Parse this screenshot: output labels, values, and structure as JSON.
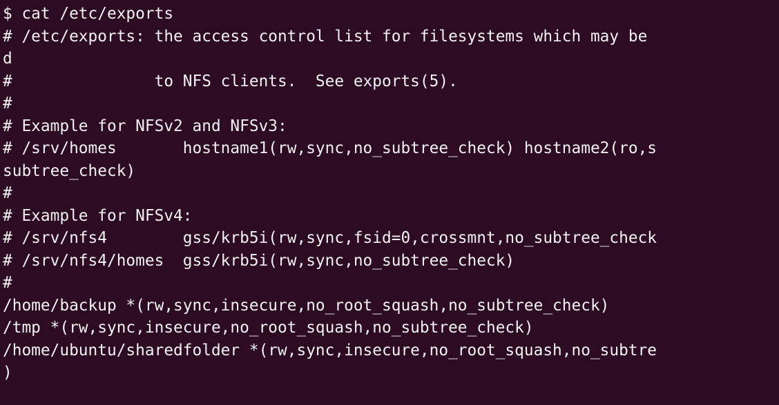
{
  "terminal": {
    "lines": [
      "$ cat /etc/exports",
      "# /etc/exports: the access control list for filesystems which may be",
      "d",
      "#               to NFS clients.  See exports(5).",
      "#",
      "# Example for NFSv2 and NFSv3:",
      "# /srv/homes       hostname1(rw,sync,no_subtree_check) hostname2(ro,s",
      "subtree_check)",
      "#",
      "# Example for NFSv4:",
      "# /srv/nfs4        gss/krb5i(rw,sync,fsid=0,crossmnt,no_subtree_check",
      "# /srv/nfs4/homes  gss/krb5i(rw,sync,no_subtree_check)",
      "#",
      "/home/backup *(rw,sync,insecure,no_root_squash,no_subtree_check)",
      "/tmp *(rw,sync,insecure,no_root_squash,no_subtree_check)",
      "/home/ubuntu/sharedfolder *(rw,sync,insecure,no_root_squash,no_subtre",
      ")"
    ]
  }
}
